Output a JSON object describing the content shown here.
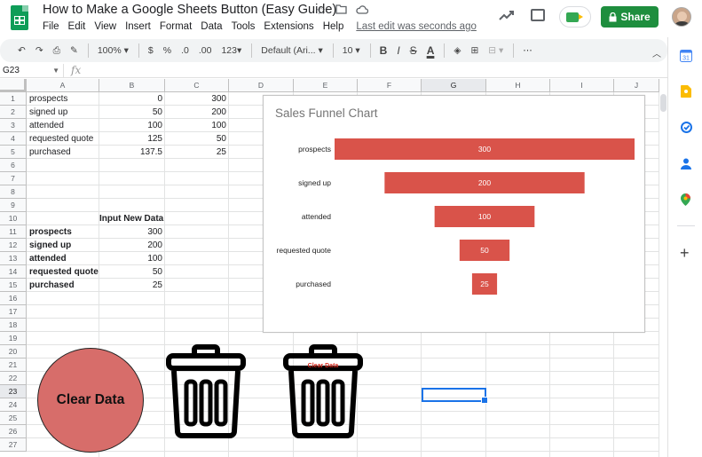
{
  "header": {
    "title": "How to Make a Google Sheets Button (Easy Guide)",
    "menu": [
      "File",
      "Edit",
      "View",
      "Insert",
      "Format",
      "Data",
      "Tools",
      "Extensions",
      "Help"
    ],
    "last_edit": "Last edit was seconds ago",
    "share_label": "Share",
    "icons": [
      "star-icon",
      "move-folder-icon",
      "cloud-status-icon",
      "activity-trend-icon",
      "comment-icon",
      "meet-icon"
    ]
  },
  "toolbar": {
    "zoom": "100%",
    "currency": "$",
    "percent": "%",
    "decimal_less": ".0",
    "decimal_more": ".00",
    "number_format": "123",
    "font": "Default (Ari...",
    "font_size": "10",
    "bold": "B",
    "italic": "I",
    "strike": "S",
    "text_color": "A",
    "more": "⋯"
  },
  "formula_bar": {
    "name_box": "G23",
    "fx": "fx"
  },
  "columns": [
    "A",
    "B",
    "C",
    "D",
    "E",
    "F",
    "G",
    "H",
    "I",
    "J"
  ],
  "rows": [
    "1",
    "2",
    "3",
    "4",
    "5",
    "6",
    "7",
    "8",
    "9",
    "10",
    "11",
    "12",
    "13",
    "14",
    "15",
    "16",
    "17",
    "18",
    "19",
    "20",
    "21",
    "22",
    "23",
    "24",
    "25",
    "26",
    "27"
  ],
  "table1": [
    {
      "label": "prospects",
      "b": "0",
      "c": "300"
    },
    {
      "label": "signed up",
      "b": "50",
      "c": "200"
    },
    {
      "label": "attended",
      "b": "100",
      "c": "100"
    },
    {
      "label": "requested quote",
      "b": "125",
      "c": "50"
    },
    {
      "label": "purchased",
      "b": "137.5",
      "c": "25"
    }
  ],
  "table2_header": "Input New Data",
  "table2": [
    {
      "label": "prospects",
      "value": "300"
    },
    {
      "label": "signed up",
      "value": "200"
    },
    {
      "label": "attended",
      "value": "100"
    },
    {
      "label": "requested quote",
      "value": "50"
    },
    {
      "label": "purchased",
      "value": "25"
    }
  ],
  "chart_data": {
    "type": "bar",
    "title": "Sales Funnel Chart",
    "orientation": "horizontal-funnel",
    "categories": [
      "prospects",
      "signed up",
      "attended",
      "requested quote",
      "purchased"
    ],
    "offset": [
      0,
      50,
      100,
      125,
      137.5
    ],
    "values": [
      300,
      200,
      100,
      50,
      25
    ],
    "data_labels": [
      "300",
      "200",
      "100",
      "50",
      "25"
    ],
    "xlim": [
      0,
      300
    ],
    "bar_color": "#d9534a",
    "grid": false,
    "legend": "none"
  },
  "buttons": {
    "clear_circle": "Clear Data",
    "trash_label": "Clear Data"
  },
  "side_panel": [
    "calendar-icon",
    "keep-icon",
    "tasks-icon",
    "contacts-icon",
    "maps-icon",
    "add-icon"
  ],
  "colors": {
    "share_green": "#1e8e3e",
    "selection_blue": "#1a73e8",
    "circle_fill": "#d76d6a"
  }
}
